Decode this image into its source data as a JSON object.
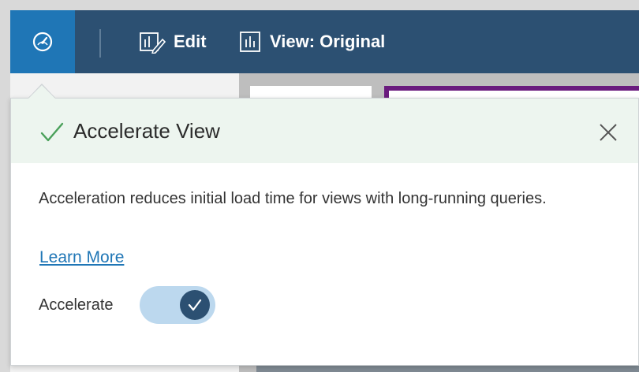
{
  "toolbar": {
    "edit_label": "Edit",
    "view_label": "View: Original",
    "icons": {
      "performance": "speedometer-icon",
      "edit": "edit-chart-icon",
      "view": "bar-chart-icon"
    }
  },
  "popup": {
    "title": "Accelerate View",
    "description": "Acceleration reduces initial load time for views with long-running queries.",
    "learn_more": "Learn More",
    "toggle_label": "Accelerate",
    "toggle_on": true,
    "icons": {
      "status": "checkmark-icon",
      "close": "close-icon"
    }
  },
  "colors": {
    "toolbar_bg": "#2c5072",
    "active_button_bg": "#1f76b6",
    "popup_header_bg": "#edf5ef",
    "check_green": "#4aa05a",
    "link_blue": "#1f76b6",
    "toggle_track": "#bcd8ee",
    "toggle_knob": "#2c5072",
    "accent_purple": "#6a1b7e"
  }
}
